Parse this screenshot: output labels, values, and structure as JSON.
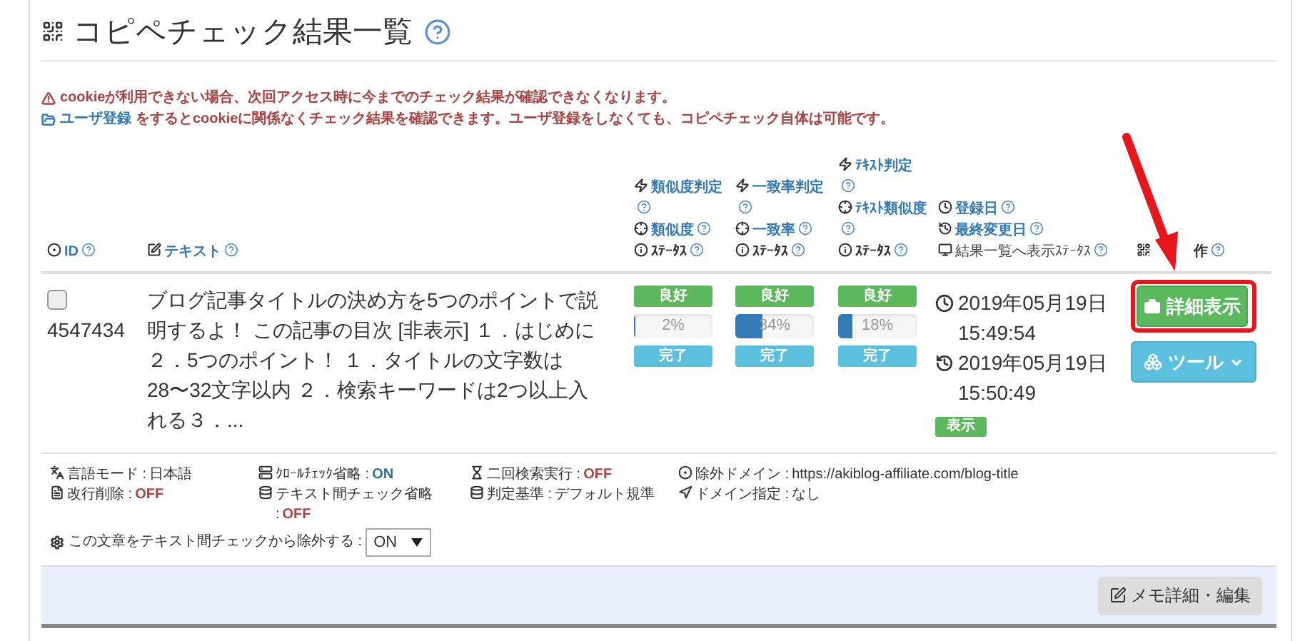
{
  "page": {
    "title": "コピペチェック結果一覧"
  },
  "notices": [
    {
      "kind": "warning",
      "text": "cookieが利用できない場合、次回アクセス時に今までのチェック結果が確認できなくなります。"
    },
    {
      "kind": "info",
      "link": "ユーザ登録",
      "text": "をするとcookieに関係なくチェック結果を確認できます。ユーザ登録をしなくても、コピペチェック自体は可能です。"
    }
  ],
  "table": {
    "columns": [
      {
        "kind": "id",
        "lines": [
          "ID"
        ]
      },
      {
        "kind": "text",
        "lines": [
          "テキスト"
        ]
      },
      {
        "kind": "metric",
        "lines": [
          "類似度判定",
          "類似度",
          "ｽﾃｰﾀｽ"
        ]
      },
      {
        "kind": "metric",
        "lines": [
          "一致率判定",
          "一致率",
          "ｽﾃｰﾀｽ"
        ]
      },
      {
        "kind": "metric",
        "lines": [
          "ﾃｷｽﾄ判定",
          "ﾃｷｽﾄ類似度",
          "ｽﾃｰﾀｽ"
        ]
      },
      {
        "kind": "date",
        "lines": [
          "登録日",
          "最終変更日",
          "結果一覧へ表示ｽﾃｰﾀｽ"
        ]
      },
      {
        "kind": "ops",
        "lines": [
          "作"
        ]
      }
    ],
    "rows": [
      {
        "checked": false,
        "id": "4547434",
        "text": "ブログ記事タイトルの決め方を5つのポイントで説明するよ！ この記事の目次 [非表示] １．はじめに２．5つのポイント！ １．タイトルの文字数は28〜32文字以内 ２．検索キーワードは2つ以上入れる３．...",
        "metrics": [
          {
            "judgement": "良好",
            "level": 0.02,
            "reading": "2%",
            "status": "完了"
          },
          {
            "judgement": "良好",
            "level": 0.34,
            "reading": "34%",
            "status": "完了"
          },
          {
            "judgement": "良好",
            "level": 0.18,
            "reading": "18%",
            "status": "完了"
          }
        ],
        "registered": "2019年05月19日 15:49:54",
        "modified": "2019年05月19日 15:50:49",
        "display": "表示",
        "detail_button": "詳細表示",
        "tool_button": "ツール",
        "highlighted": true
      }
    ]
  },
  "settings": {
    "groups": [
      [
        {
          "label": "言語モード :",
          "value": "日本語"
        },
        {
          "label": "改行削除 :",
          "value": "OFF"
        }
      ],
      [
        {
          "label": "ｸﾛｰﾙﾁｪｯｸ省略 :",
          "value": "ON"
        },
        {
          "label": "テキスト間チェック省略 :",
          "value": "OFF"
        }
      ],
      [
        {
          "label": "二回検索実行 :",
          "value": "OFF"
        },
        {
          "label": "判定基準 :",
          "value": "デフォルト規準"
        }
      ],
      [
        {
          "label": "除外ドメイン :",
          "value": "https://akiblog-affiliate.com/blog-title"
        },
        {
          "label": "ドメイン指定 :",
          "value": "なし"
        }
      ]
    ],
    "exclude": {
      "label": "この文章をテキスト間チェックから除外する :",
      "value": "ON"
    }
  },
  "memo_button": "メモ詳細・編集"
}
